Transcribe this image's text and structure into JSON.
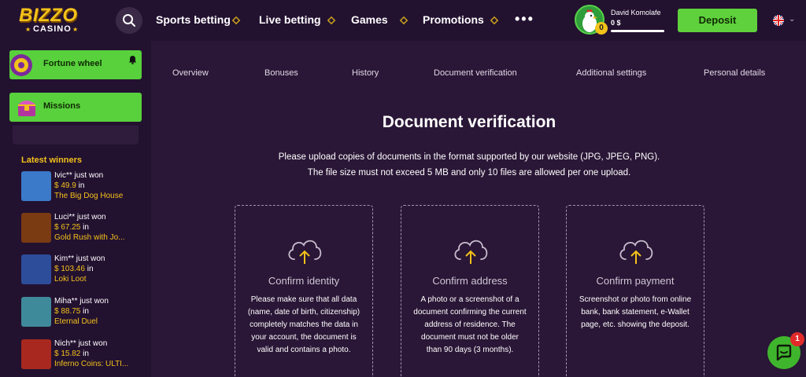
{
  "header": {
    "logo_top": "BIZZO",
    "logo_bottom": "CASINO",
    "nav": [
      "Sports betting",
      "Live betting",
      "Games",
      "Promotions"
    ],
    "more": "•••",
    "user_name": "David Komolafe",
    "user_level": "0",
    "balance": "0 $",
    "deposit_label": "Deposit",
    "language": "en-gb-flag",
    "colors": {
      "accent_green": "#5fd13c",
      "gold": "#f3c21a"
    }
  },
  "sidebar": {
    "buttons": [
      {
        "label": "Fortune wheel",
        "icon": "fortune-wheel-icon"
      },
      {
        "label": "Missions",
        "icon": "treasure-chest-icon"
      }
    ],
    "latest_winners_title": "Latest winners",
    "winners": [
      {
        "name": "Ivic** just won",
        "amount": "$ 49.9",
        "in": "in",
        "game": "The Big Dog House",
        "color": "#3a7ac9"
      },
      {
        "name": "Luci** just won",
        "amount": "$ 67.25",
        "in": "in",
        "game": "Gold Rush with Jo...",
        "color": "#7a3a12"
      },
      {
        "name": "Kim** just won",
        "amount": "$ 103.46",
        "in": "in",
        "game": "Loki Loot",
        "color": "#2d4d9a"
      },
      {
        "name": "Miha** just won",
        "amount": "$ 88.75",
        "in": "in",
        "game": "Eternal Duel",
        "color": "#3f8a9a"
      },
      {
        "name": "Nich** just won",
        "amount": "$ 15.82",
        "in": "in",
        "game": "Inferno Coins: ULTI...",
        "color": "#a8281f"
      }
    ]
  },
  "tabs": [
    "Overview",
    "Bonuses",
    "History",
    "Document verification",
    "Additional settings",
    "Personal details"
  ],
  "main": {
    "title": "Document verification",
    "desc_line1": "Please upload copies of documents in the format supported by our website (JPG, JPEG, PNG).",
    "desc_line2": "The file size must not exceed 5 MB and only 10 files are allowed per one upload.",
    "cards": [
      {
        "title": "Confirm identity",
        "desc": "Please make sure that all data (name, date of birth, citizenship) completely matches the data in your account, the document is valid and contains a photo."
      },
      {
        "title": "Confirm address",
        "desc": "A photo or a screenshot of a document confirming the current address of residence. The document must not be older than 90 days (3 months)."
      },
      {
        "title": "Confirm payment",
        "desc": "Screenshot or photo from online bank, bank statement, e-Wallet page, etc. showing the deposit."
      }
    ]
  },
  "chat": {
    "badge": "1"
  }
}
